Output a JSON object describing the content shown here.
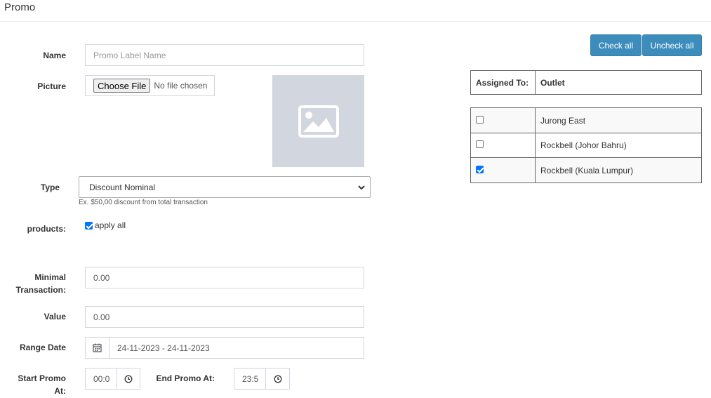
{
  "page": {
    "title": "Promo"
  },
  "form": {
    "name": {
      "label": "Name",
      "placeholder": "Promo Label Name"
    },
    "picture": {
      "label": "Picture",
      "button": "Choose File",
      "status": "No file chosen"
    },
    "type": {
      "label": "Type",
      "selected": "Discount Nominal",
      "help": "Ex. $50,00 discount from total transaction"
    },
    "products": {
      "label": "products:",
      "apply_all_label": "apply all",
      "apply_all_checked": true
    },
    "minimal_transaction": {
      "label_line1": "Minimal",
      "label_line2": "Transaction:",
      "value": "0.00"
    },
    "value": {
      "label": "Value",
      "value": "0.00"
    },
    "range_date": {
      "label": "Range Date",
      "value": "24-11-2023 - 24-11-2023"
    },
    "start_promo": {
      "label_line1": "Start Promo",
      "label_line2": "At:",
      "value": "00:0"
    },
    "end_promo": {
      "label": "End Promo At:",
      "value": "23:5"
    }
  },
  "assign": {
    "check_all": "Check all",
    "uncheck_all": "Uncheck all",
    "header_assigned": "Assigned To:",
    "header_outlet": "Outlet",
    "outlets": [
      {
        "name": "Jurong East",
        "checked": false
      },
      {
        "name": "Rockbell (Johor Bahru)",
        "checked": false
      },
      {
        "name": "Rockbell (Kuala Lumpur)",
        "checked": true
      }
    ]
  },
  "colors": {
    "primary_button": "#3c8dbc",
    "input_border": "#d2d6de",
    "checkbox_on": "#0075ff"
  }
}
